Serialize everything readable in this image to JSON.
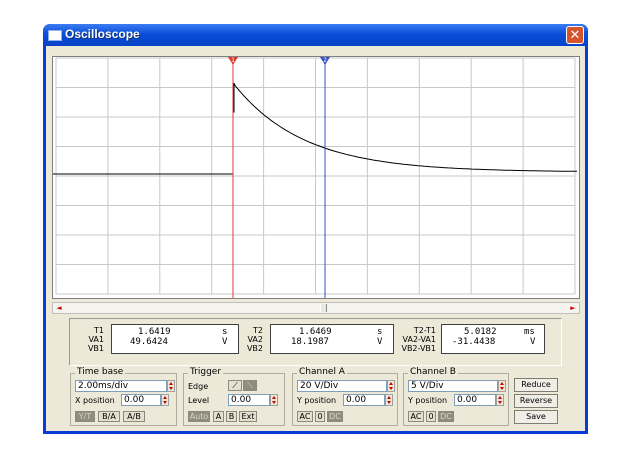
{
  "window": {
    "title": "Oscilloscope",
    "close_glyph": "✕"
  },
  "screen": {
    "background": "#ffffff",
    "grid_color": "#c8c8c8",
    "trace_color": "#000000",
    "cursor1_color": "#e03a2a",
    "cursor2_color": "#3552c8",
    "cursor1_label": "1",
    "cursor2_label": "2"
  },
  "readout": {
    "t1_label": "T1",
    "t1_value": "1.6419",
    "t1_unit": "s",
    "va1_label": "VA1",
    "va1_value": "49.6424",
    "va1_unit": "V",
    "vb1_label": "VB1",
    "t2_label": "T2",
    "t2_value": "1.6469",
    "t2_unit": "s",
    "va2_label": "VA2",
    "va2_value": "18.1987",
    "va2_unit": "V",
    "vb2_label": "VB2",
    "dt_label": "T2-T1",
    "dt_value": "5.0182",
    "dt_unit": "ms",
    "dva_label": "VA2-VA1",
    "dva_value": "-31.4438",
    "dva_unit": "V",
    "dvb_label": "VB2-VB1"
  },
  "timebase": {
    "label": "Time base",
    "value": "2.00ms/div",
    "xpos_label": "X position",
    "xpos_value": "0.00",
    "modes": [
      "Y/T",
      "B/A",
      "A/B"
    ]
  },
  "trigger": {
    "label": "Trigger",
    "edge_label": "Edge",
    "level_label": "Level",
    "level_value": "0.00",
    "sources": [
      "Auto",
      "A",
      "B",
      "Ext"
    ]
  },
  "channel_a": {
    "label": "Channel A",
    "value": "20 V/Div",
    "ypos_label": "Y position",
    "ypos_value": "0.00",
    "coupling": [
      "AC",
      "0",
      "DC"
    ]
  },
  "channel_b": {
    "label": "Channel B",
    "value": "5 V/Div",
    "ypos_label": "Y position",
    "ypos_value": "0.00",
    "coupling": [
      "AC",
      "0",
      "DC"
    ]
  },
  "buttons": {
    "reduce": "Reduce",
    "reverse": "Reverse",
    "save": "Save"
  }
}
